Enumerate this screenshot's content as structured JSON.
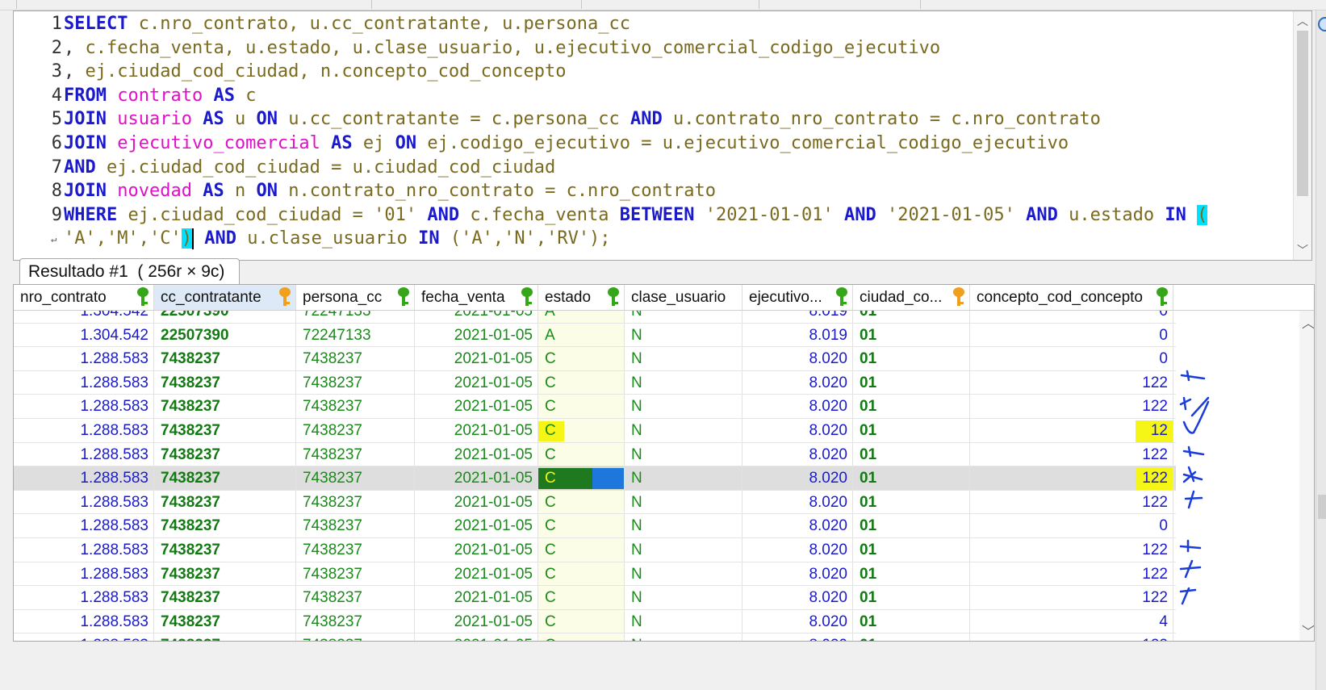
{
  "editor": {
    "lines": [
      {
        "n": "1",
        "html_tokens": [
          [
            "kw",
            "SELECT"
          ],
          [
            "id",
            " c.nro_contrato, u.cc_contratante, u.persona_cc"
          ]
        ]
      },
      {
        "n": "2",
        "html_tokens": [
          [
            "pn",
            ", "
          ],
          [
            "id",
            "c.fecha_venta, u.estado, u.clase_usuario, u.ejecutivo_comercial_codigo_ejecutivo"
          ]
        ]
      },
      {
        "n": "3",
        "html_tokens": [
          [
            "pn",
            ", "
          ],
          [
            "id",
            "ej.ciudad_cod_ciudad, n.concepto_cod_concepto"
          ]
        ]
      },
      {
        "n": "4",
        "html_tokens": [
          [
            "kw",
            "FROM"
          ],
          [
            "pn",
            " "
          ],
          [
            "tb",
            "contrato"
          ],
          [
            "pn",
            " "
          ],
          [
            "kw",
            "AS"
          ],
          [
            "id",
            " c"
          ]
        ]
      },
      {
        "n": "5",
        "html_tokens": [
          [
            "kw",
            "JOIN"
          ],
          [
            "pn",
            " "
          ],
          [
            "tb",
            "usuario"
          ],
          [
            "pn",
            " "
          ],
          [
            "kw",
            "AS"
          ],
          [
            "id",
            " u "
          ],
          [
            "kw",
            "ON"
          ],
          [
            "id",
            " u.cc_contratante = c.persona_cc "
          ],
          [
            "kw",
            "AND"
          ],
          [
            "id",
            " u.contrato_nro_contrato = c.nro_contrato"
          ]
        ]
      },
      {
        "n": "6",
        "html_tokens": [
          [
            "kw",
            "JOIN"
          ],
          [
            "pn",
            " "
          ],
          [
            "tb",
            "ejecutivo_comercial"
          ],
          [
            "pn",
            " "
          ],
          [
            "kw",
            "AS"
          ],
          [
            "id",
            " ej "
          ],
          [
            "kw",
            "ON"
          ],
          [
            "id",
            " ej.codigo_ejecutivo = u.ejecutivo_comercial_codigo_ejecutivo"
          ]
        ]
      },
      {
        "n": "7",
        "html_tokens": [
          [
            "kw",
            "AND"
          ],
          [
            "id",
            " ej.ciudad_cod_ciudad = u.ciudad_cod_ciudad"
          ]
        ]
      },
      {
        "n": "8",
        "html_tokens": [
          [
            "kw",
            "JOIN"
          ],
          [
            "pn",
            " "
          ],
          [
            "tb",
            "novedad"
          ],
          [
            "pn",
            " "
          ],
          [
            "kw",
            "AS"
          ],
          [
            "id",
            " n "
          ],
          [
            "kw",
            "ON"
          ],
          [
            "id",
            " n.contrato_nro_contrato = c.nro_contrato"
          ]
        ]
      },
      {
        "n": "9",
        "html_tokens": [
          [
            "kw",
            "WHERE"
          ],
          [
            "id",
            " ej.ciudad_cod_ciudad = "
          ],
          [
            "sv",
            "'01'"
          ],
          [
            "pn",
            " "
          ],
          [
            "kw",
            "AND"
          ],
          [
            "id",
            " c.fecha_venta "
          ],
          [
            "kw",
            "BETWEEN"
          ],
          [
            "pn",
            " "
          ],
          [
            "sv",
            "'2021-01-01'"
          ],
          [
            "pn",
            " "
          ],
          [
            "kw",
            "AND"
          ],
          [
            "pn",
            " "
          ],
          [
            "sv",
            "'2021-01-05'"
          ],
          [
            "pn",
            " "
          ],
          [
            "kw",
            "AND"
          ],
          [
            "id",
            " u.estado "
          ],
          [
            "kw",
            "IN"
          ],
          [
            "pn",
            " "
          ],
          [
            "hl",
            "("
          ]
        ]
      },
      {
        "n": "",
        "html_tokens": [
          [
            "sv",
            "'A','M','C'"
          ],
          [
            "hl",
            ")"
          ],
          [
            "caret",
            ""
          ],
          [
            "pn",
            " "
          ],
          [
            "kw",
            "AND"
          ],
          [
            "id",
            " u.clase_usuario "
          ],
          [
            "kw",
            "IN"
          ],
          [
            "pn",
            " "
          ],
          [
            "sv",
            "('A','N','RV');"
          ]
        ]
      }
    ]
  },
  "result_tab": {
    "label": "Resultado #1  ( 256r × 9c)"
  },
  "grid": {
    "columns": [
      {
        "label": "nro_contrato",
        "key": "green"
      },
      {
        "label": "cc_contratante",
        "key": "orange"
      },
      {
        "label": "persona_cc",
        "key": "green"
      },
      {
        "label": "fecha_venta",
        "key": "green"
      },
      {
        "label": "estado",
        "key": "green"
      },
      {
        "label": "clase_usuario",
        "key": ""
      },
      {
        "label": "ejecutivo...",
        "key": "green"
      },
      {
        "label": "ciudad_co...",
        "key": "orange"
      },
      {
        "label": "concepto_cod_concepto",
        "key": "green"
      }
    ],
    "partial_top_row": [
      "1.304.542",
      "22507390",
      "72247133",
      "2021-01-05",
      "A",
      "N",
      "8.019",
      "01",
      "0"
    ],
    "rows": [
      [
        "1.304.542",
        "22507390",
        "72247133",
        "2021-01-05",
        "A",
        "N",
        "8.019",
        "01",
        "0"
      ],
      [
        "1.288.583",
        "7438237",
        "7438237",
        "2021-01-05",
        "C",
        "N",
        "8.020",
        "01",
        "0"
      ],
      [
        "1.288.583",
        "7438237",
        "7438237",
        "2021-01-05",
        "C",
        "N",
        "8.020",
        "01",
        "122"
      ],
      [
        "1.288.583",
        "7438237",
        "7438237",
        "2021-01-05",
        "C",
        "N",
        "8.020",
        "01",
        "122"
      ],
      [
        "1.288.583",
        "7438237",
        "7438237",
        "2021-01-05",
        "C",
        "N",
        "8.020",
        "01",
        "12"
      ],
      [
        "1.288.583",
        "7438237",
        "7438237",
        "2021-01-05",
        "C",
        "N",
        "8.020",
        "01",
        "122"
      ],
      [
        "1.288.583",
        "7438237",
        "7438237",
        "2021-01-05",
        "C",
        "N",
        "8.020",
        "01",
        "122"
      ],
      [
        "1.288.583",
        "7438237",
        "7438237",
        "2021-01-05",
        "C",
        "N",
        "8.020",
        "01",
        "122"
      ],
      [
        "1.288.583",
        "7438237",
        "7438237",
        "2021-01-05",
        "C",
        "N",
        "8.020",
        "01",
        "0"
      ],
      [
        "1.288.583",
        "7438237",
        "7438237",
        "2021-01-05",
        "C",
        "N",
        "8.020",
        "01",
        "122"
      ],
      [
        "1.288.583",
        "7438237",
        "7438237",
        "2021-01-05",
        "C",
        "N",
        "8.020",
        "01",
        "122"
      ],
      [
        "1.288.583",
        "7438237",
        "7438237",
        "2021-01-05",
        "C",
        "N",
        "8.020",
        "01",
        "122"
      ],
      [
        "1.288.583",
        "7438237",
        "7438237",
        "2021-01-05",
        "C",
        "N",
        "8.020",
        "01",
        "4"
      ]
    ],
    "selected_row_index": 6,
    "highlighted_concept_rows": [
      4,
      6
    ],
    "highlighted_estado_row": 4
  },
  "colors": {
    "keyword": "#1a1acc",
    "table": "#e010c8",
    "identifier": "#7a6a1e",
    "selection": "#1e78dc",
    "highlight": "#f5f516"
  }
}
